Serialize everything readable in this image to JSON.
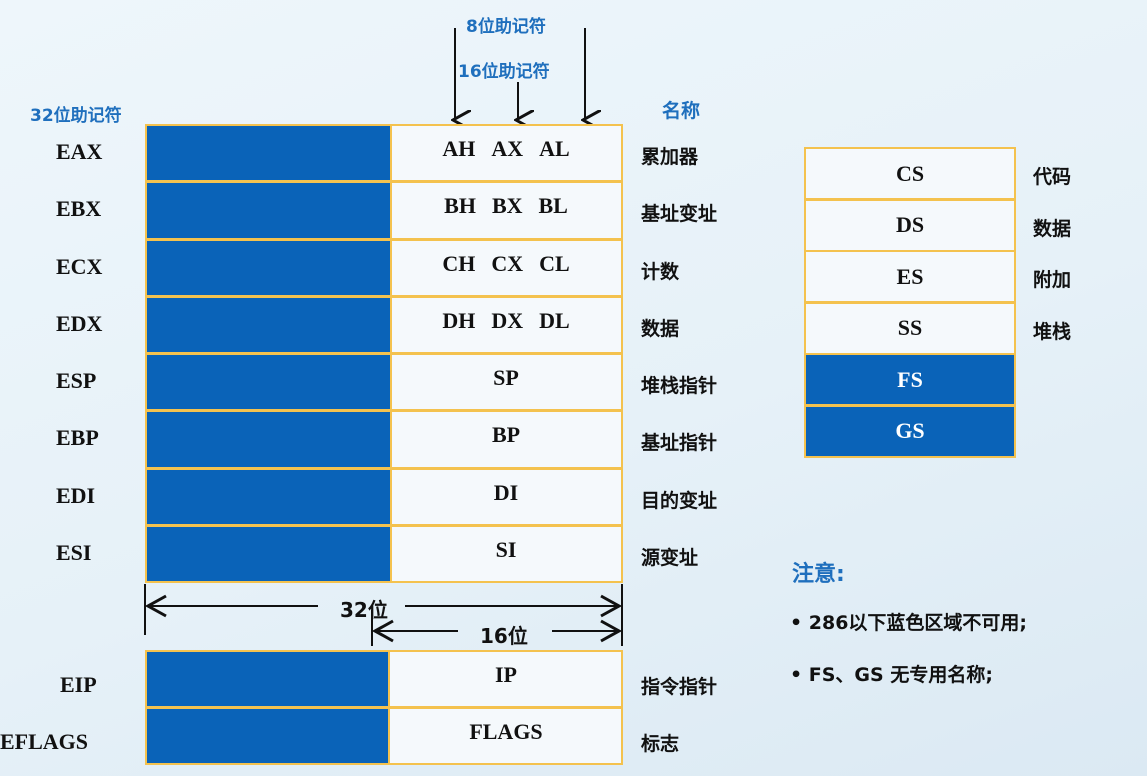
{
  "labels": {
    "bit8": "8位助记符",
    "bit16": "16位助记符",
    "bit32": "32位助记符",
    "name": "名称"
  },
  "general_registers": [
    {
      "r32": "EAX",
      "parts": [
        "AH",
        "AX",
        "AL"
      ],
      "name": "累加器"
    },
    {
      "r32": "EBX",
      "parts": [
        "BH",
        "BX",
        "BL"
      ],
      "name": "基址变址"
    },
    {
      "r32": "ECX",
      "parts": [
        "CH",
        "CX",
        "CL"
      ],
      "name": "计数"
    },
    {
      "r32": "EDX",
      "parts": [
        "DH",
        "DX",
        "DL"
      ],
      "name": "数据"
    },
    {
      "r32": "ESP",
      "r16": "SP",
      "name": "堆栈指针"
    },
    {
      "r32": "EBP",
      "r16": "BP",
      "name": "基址指针"
    },
    {
      "r32": "EDI",
      "r16": "DI",
      "name": "目的变址"
    },
    {
      "r32": "ESI",
      "r16": "SI",
      "name": "源变址"
    }
  ],
  "widths": {
    "w32": "32位",
    "w16": "16位"
  },
  "control_registers": [
    {
      "r32": "EIP",
      "r16": "IP",
      "name": "指令指针"
    },
    {
      "r32": "EFLAGS",
      "r16": "FLAGS",
      "name": "标志"
    }
  ],
  "segment_registers": [
    {
      "reg": "CS",
      "name": "代码",
      "color": "white"
    },
    {
      "reg": "DS",
      "name": "数据",
      "color": "white"
    },
    {
      "reg": "ES",
      "name": "附加",
      "color": "white"
    },
    {
      "reg": "SS",
      "name": "堆栈",
      "color": "white"
    },
    {
      "reg": "FS",
      "name": "",
      "color": "blue"
    },
    {
      "reg": "GS",
      "name": "",
      "color": "blue"
    }
  ],
  "notes": {
    "title": "注意:",
    "items": [
      "• 286以下蓝色区域不可用;",
      "• FS、GS 无专用名称;"
    ]
  },
  "colors": {
    "blue": "#0a63b8",
    "border": "#f4c24e",
    "accent_text": "#1f6fbd"
  }
}
